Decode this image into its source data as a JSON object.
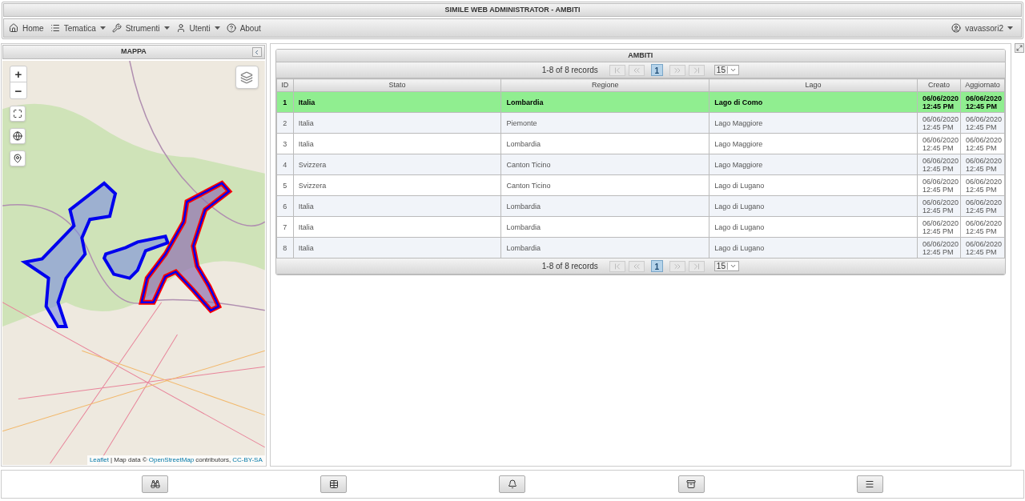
{
  "window": {
    "title": "SIMILE WEB ADMINISTRATOR - AMBITI"
  },
  "nav": {
    "items": [
      {
        "label": "Home",
        "dropdown": false,
        "kind": "home"
      },
      {
        "label": "Tematica",
        "dropdown": true,
        "kind": "list"
      },
      {
        "label": "Strumenti",
        "dropdown": true,
        "kind": "tools"
      },
      {
        "label": "Utenti",
        "dropdown": true,
        "kind": "user"
      },
      {
        "label": "About",
        "dropdown": false,
        "kind": "help"
      }
    ],
    "user": {
      "label": "vavassori2",
      "dropdown": true
    }
  },
  "map_panel": {
    "title": "MAPPA",
    "zoom_in": "+",
    "zoom_out": "−",
    "attribution": {
      "leaflet": "Leaflet",
      "text": "| Map data ©",
      "osm": "OpenStreetMap",
      "contributors": "contributors,",
      "license": "CC-BY-SA"
    }
  },
  "table": {
    "title": "AMBITI",
    "pager_top": {
      "summary": "1-8 of 8 records",
      "page": "1",
      "page_size": "15"
    },
    "columns": [
      "ID",
      "Stato",
      "Regione",
      "Lago",
      "Creato",
      "Aggiornato"
    ],
    "rows": [
      {
        "cells": [
          "1",
          "Italia",
          "Lombardia",
          "Lago di Como",
          "06/06/2020 12:45 PM",
          "06/06/2020 12:45 PM"
        ],
        "selected": true
      },
      {
        "cells": [
          "2",
          "Italia",
          "Piemonte",
          "Lago Maggiore",
          "06/06/2020 12:45 PM",
          "06/06/2020 12:45 PM"
        ],
        "selected": false
      },
      {
        "cells": [
          "3",
          "Italia",
          "Lombardia",
          "Lago Maggiore",
          "06/06/2020 12:45 PM",
          "06/06/2020 12:45 PM"
        ],
        "selected": false
      },
      {
        "cells": [
          "4",
          "Svizzera",
          "Canton Ticino",
          "Lago Maggiore",
          "06/06/2020 12:45 PM",
          "06/06/2020 12:45 PM"
        ],
        "selected": false
      },
      {
        "cells": [
          "5",
          "Svizzera",
          "Canton Ticino",
          "Lago di Lugano",
          "06/06/2020 12:45 PM",
          "06/06/2020 12:45 PM"
        ],
        "selected": false
      },
      {
        "cells": [
          "6",
          "Italia",
          "Lombardia",
          "Lago di Lugano",
          "06/06/2020 12:45 PM",
          "06/06/2020 12:45 PM"
        ],
        "selected": false
      },
      {
        "cells": [
          "7",
          "Italia",
          "Lombardia",
          "Lago di Lugano",
          "06/06/2020 12:45 PM",
          "06/06/2020 12:45 PM"
        ],
        "selected": false
      },
      {
        "cells": [
          "8",
          "Italia",
          "Lombardia",
          "Lago di Lugano",
          "06/06/2020 12:45 PM",
          "06/06/2020 12:45 PM"
        ],
        "selected": false
      }
    ],
    "pager_bottom": {
      "summary": "1-8 of 8 records",
      "page": "1",
      "page_size": "15"
    }
  }
}
